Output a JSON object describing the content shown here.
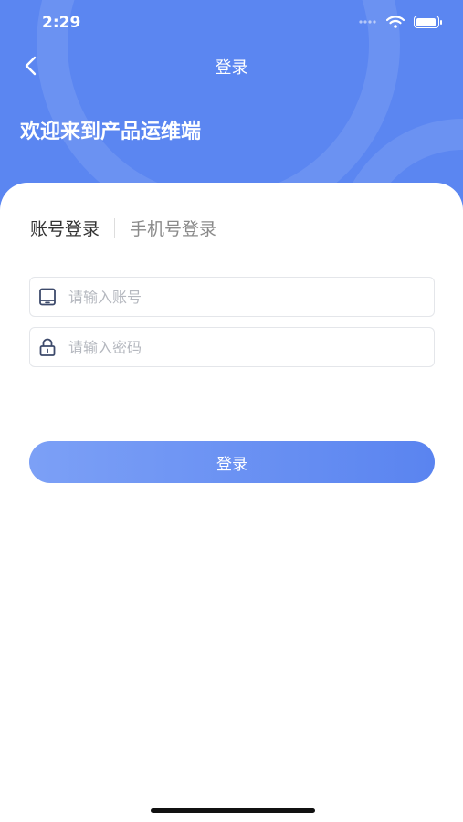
{
  "status_bar": {
    "time": "2:29"
  },
  "nav": {
    "title": "登录"
  },
  "welcome": "欢迎来到产品运维端",
  "tabs": [
    {
      "label": "账号登录",
      "active": true
    },
    {
      "label": "手机号登录",
      "active": false
    }
  ],
  "form": {
    "account_placeholder": "请输入账号",
    "password_placeholder": "请输入密码"
  },
  "login_button": "登录",
  "colors": {
    "primary": "#5b86f1",
    "button_start": "#7ca0f6",
    "button_end": "#5a84f0"
  }
}
